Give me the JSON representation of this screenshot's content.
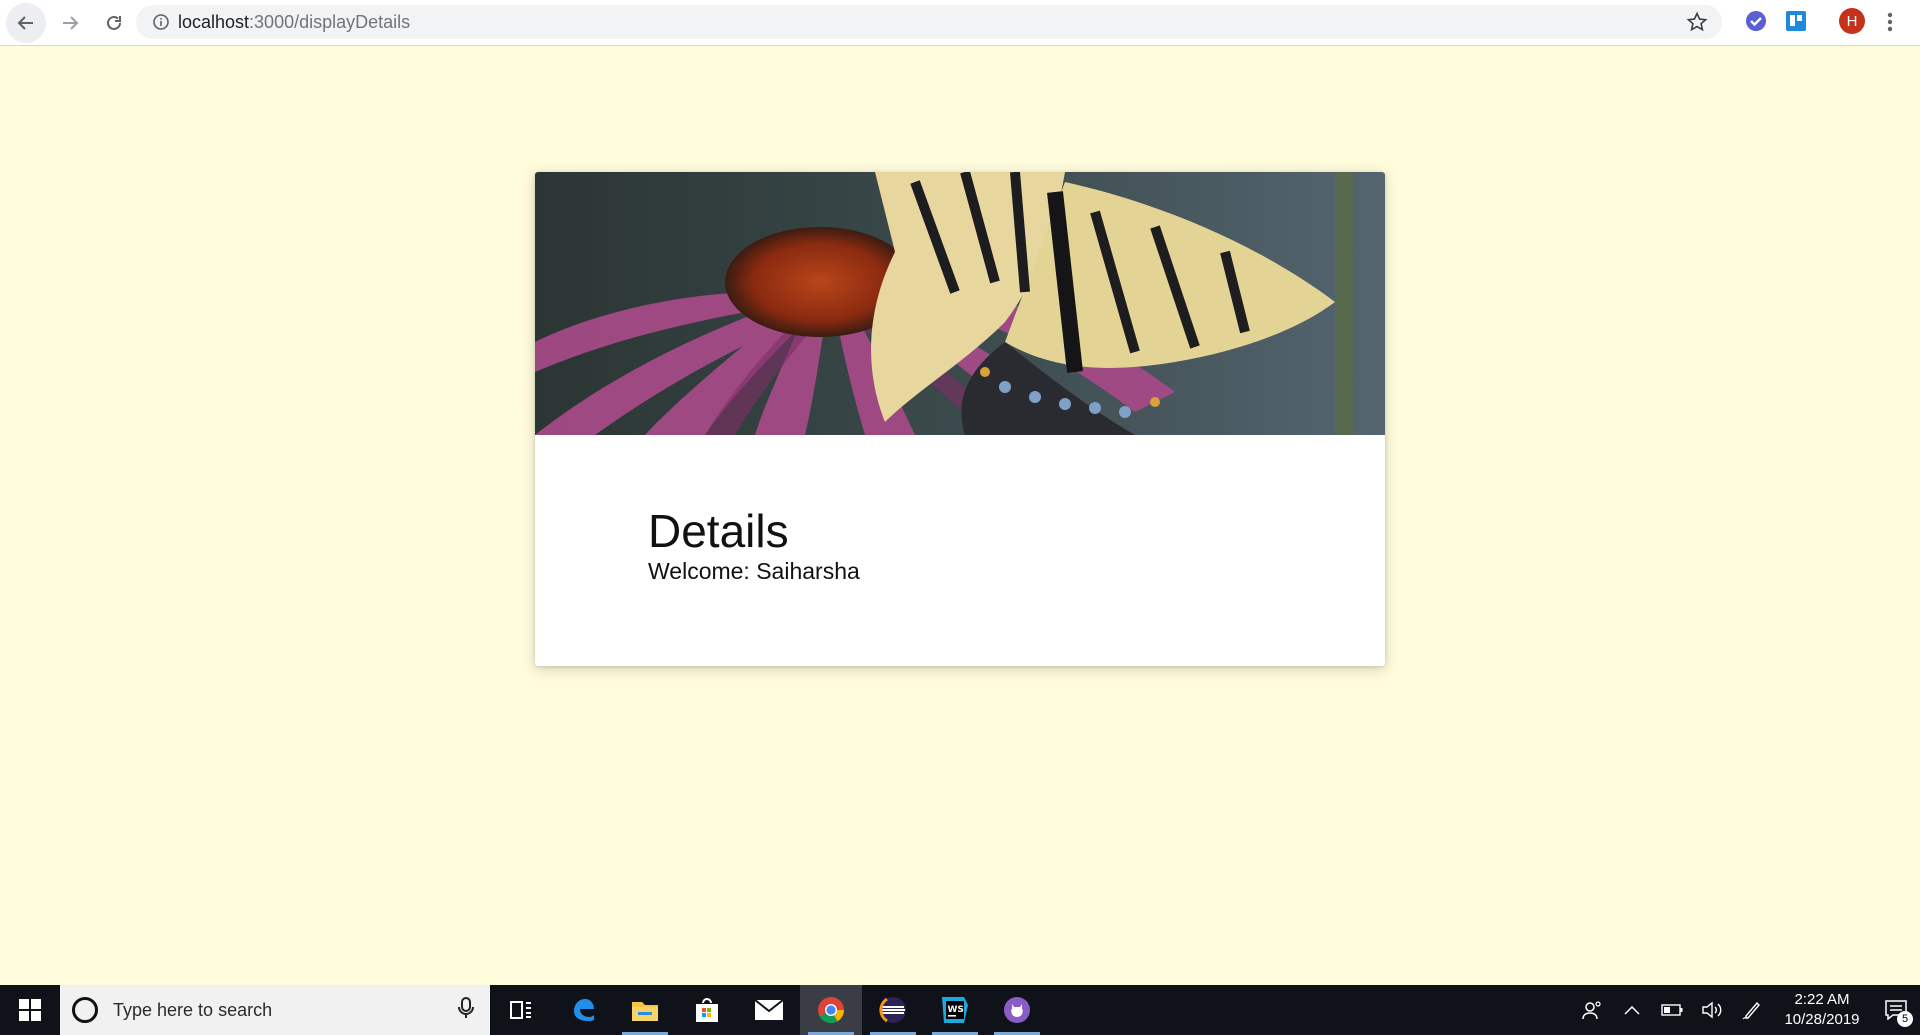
{
  "browser": {
    "url_host": "localhost",
    "url_path": ":3000/displayDetails",
    "profile_initial": "H",
    "accent_profile": "#c5311a"
  },
  "card": {
    "image_subject": "butterfly-on-coneflower",
    "title": "Details",
    "subtitle": "Welcome: Saiharsha"
  },
  "taskbar": {
    "search_placeholder": "Type here to search",
    "apps": [
      "task-view",
      "edge",
      "file-explorer",
      "store",
      "mail",
      "chrome",
      "eclipse",
      "webstorm",
      "github-desktop"
    ],
    "time": "2:22 AM",
    "date": "10/28/2019",
    "notification_count": "5"
  },
  "colors": {
    "page_background": "#fffcdc",
    "taskbar_background": "#10121a"
  }
}
